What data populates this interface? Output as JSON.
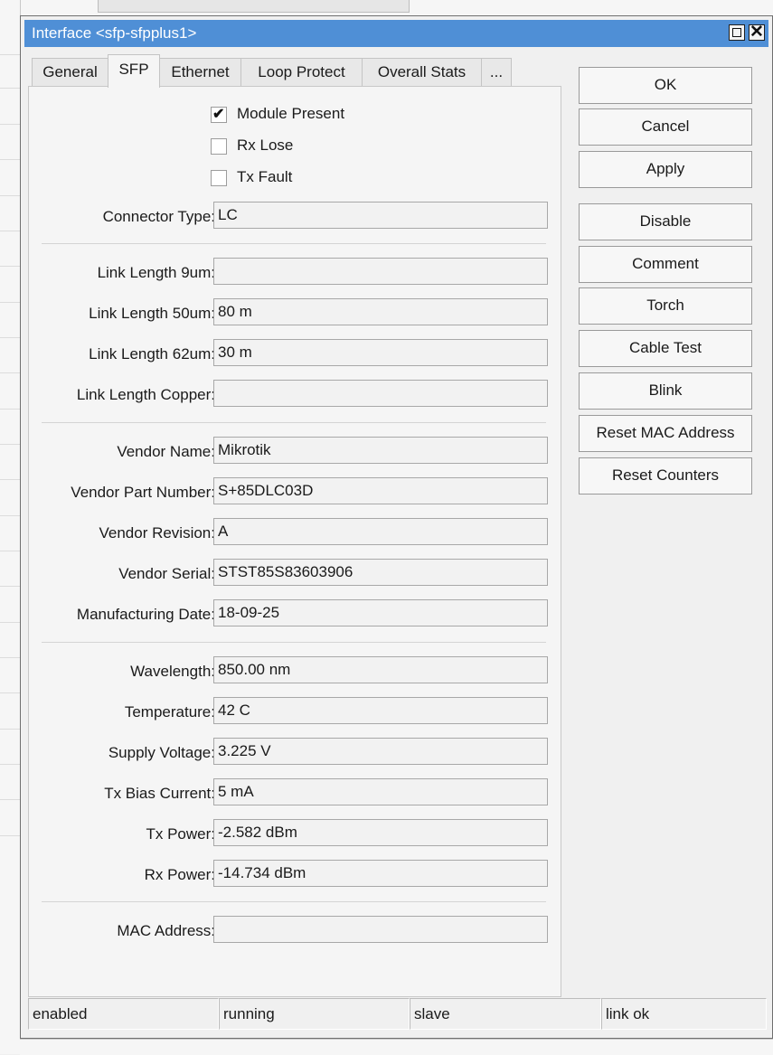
{
  "window": {
    "title": "Interface <sfp-sfpplus1>",
    "title_bar_color": "#4f8fd6"
  },
  "titlebar_buttons": {
    "restore_icon": "restore-window-icon",
    "close_icon": "close-icon",
    "close_glyph": "✕"
  },
  "tabs": [
    {
      "label": "General",
      "active": false
    },
    {
      "label": "SFP",
      "active": true
    },
    {
      "label": "Ethernet",
      "active": false
    },
    {
      "label": "Loop Protect",
      "active": false
    },
    {
      "label": "Overall Stats",
      "active": false
    },
    {
      "label": "...",
      "active": false
    }
  ],
  "checkboxes": [
    {
      "label": "Module Present",
      "checked": true
    },
    {
      "label": "Rx Lose",
      "checked": false
    },
    {
      "label": "Tx Fault",
      "checked": false
    }
  ],
  "fields": {
    "connector_type": {
      "label": "Connector Type:",
      "value": "LC"
    },
    "link_length_9um": {
      "label": "Link Length 9um:",
      "value": ""
    },
    "link_length_50um": {
      "label": "Link Length 50um:",
      "value": "80 m"
    },
    "link_length_62um": {
      "label": "Link Length 62um:",
      "value": "30 m"
    },
    "link_length_copper": {
      "label": "Link Length Copper:",
      "value": ""
    },
    "vendor_name": {
      "label": "Vendor Name:",
      "value": "Mikrotik"
    },
    "vendor_part_number": {
      "label": "Vendor Part Number:",
      "value": "S+85DLC03D"
    },
    "vendor_revision": {
      "label": "Vendor Revision:",
      "value": "A"
    },
    "vendor_serial": {
      "label": "Vendor Serial:",
      "value": "STST85S83603906"
    },
    "manufacturing_date": {
      "label": "Manufacturing Date:",
      "value": "18-09-25"
    },
    "wavelength": {
      "label": "Wavelength:",
      "value": "850.00 nm"
    },
    "temperature": {
      "label": "Temperature:",
      "value": "42 C"
    },
    "supply_voltage": {
      "label": "Supply Voltage:",
      "value": "3.225 V"
    },
    "tx_bias_current": {
      "label": "Tx Bias Current:",
      "value": "5 mA"
    },
    "tx_power": {
      "label": "Tx Power:",
      "value": "-2.582 dBm"
    },
    "rx_power": {
      "label": "Rx Power:",
      "value": "-14.734 dBm"
    },
    "mac_address": {
      "label": "MAC Address:",
      "value": ""
    }
  },
  "buttons": {
    "ok": "OK",
    "cancel": "Cancel",
    "apply": "Apply",
    "disable": "Disable",
    "comment": "Comment",
    "torch": "Torch",
    "cable_test": "Cable Test",
    "blink": "Blink",
    "reset_mac_address": "Reset MAC Address",
    "reset_counters": "Reset Counters"
  },
  "status_bar": [
    "enabled",
    "running",
    "slave",
    "link ok"
  ]
}
